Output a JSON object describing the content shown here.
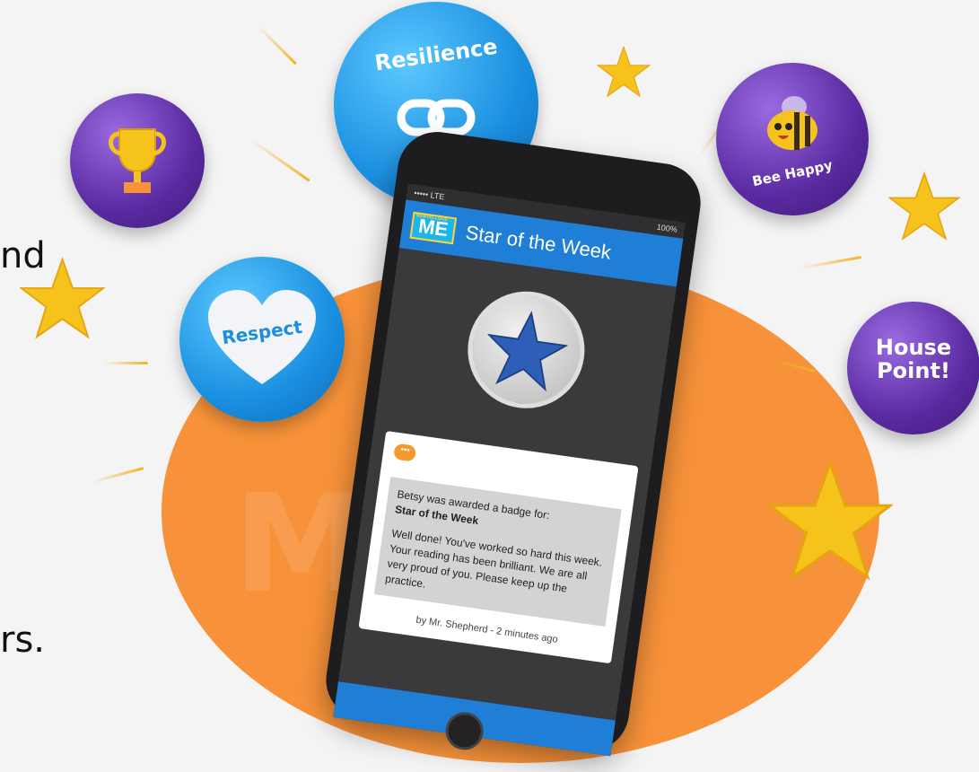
{
  "slide": {
    "text_fragment_1": "nd",
    "text_fragment_2": "rs."
  },
  "badges": {
    "resilience": "Resilience",
    "respect": "Respect",
    "bee_happy": "Bee Happy",
    "house_point_line1": "House",
    "house_point_line2": "Point!"
  },
  "phone": {
    "carrier": "••••• LTE",
    "battery": "100%",
    "logo_small": "MARVELLOUS",
    "logo": "ME",
    "title": "Star of the Week",
    "card_intro": "Betsy was awarded a badge for:",
    "card_badge": "Star of the Week",
    "card_message": "Well done! You've worked so hard this week. Your reading has been brilliant. We are all very proud of you. Please keep up the practice.",
    "byline": "by Mr. Shepherd - 2 minutes ago"
  },
  "colors": {
    "orange_blob": "#f7923a",
    "app_blue": "#1f7fd6",
    "purple_badge": "#6a3ab8",
    "blue_badge": "#1a8fe0",
    "star_gold": "#f6c21c"
  }
}
